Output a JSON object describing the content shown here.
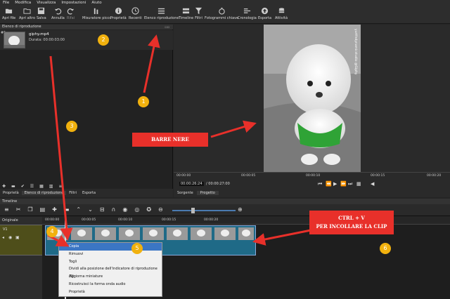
{
  "menubar": [
    "File",
    "Modifica",
    "Visualizza",
    "Impostazioni",
    "Aiuto"
  ],
  "toolbar": [
    {
      "label": "Apri file",
      "icon": "folder-icon"
    },
    {
      "label": "Apri altro",
      "icon": "folder-open-icon"
    },
    {
      "label": "Salva",
      "icon": "save-icon"
    },
    {
      "label": "Annulla",
      "icon": "undo-icon"
    },
    {
      "label": "Rifai",
      "icon": "redo-icon"
    },
    {
      "label": "Misuratore picco",
      "icon": "peak-meter-icon"
    },
    {
      "label": "Proprietà",
      "icon": "info-icon"
    },
    {
      "label": "Recenti",
      "icon": "clock-icon"
    },
    {
      "label": "Elenco riproduzione",
      "icon": "list-icon"
    },
    {
      "label": "Timeline",
      "icon": "timeline-icon"
    },
    {
      "label": "Filtri",
      "icon": "filter-icon"
    },
    {
      "label": "Fotogrammi chiave",
      "icon": "stopwatch-icon"
    },
    {
      "label": "Cronologia",
      "icon": "history-icon"
    },
    {
      "label": "Esporta",
      "icon": "export-icon"
    },
    {
      "label": "Attività",
      "icon": "tasks-icon"
    }
  ],
  "playlist": {
    "title": "Elenco di riproduzione",
    "index": "#1",
    "clip_name": "giphy.mp4",
    "clip_duration": "Durata: 00:00:03:00"
  },
  "viewer": {
    "watermark": "yurtfedynamicstudio @Giphy",
    "ruler_ticks": [
      "00:00:00",
      "00:00:05",
      "00:00:10",
      "00:00:15",
      "00:00:20"
    ],
    "timecode": "00:00:26:24",
    "total": "/ 00:00:27:00",
    "tabs": [
      "Sorgente",
      "Progetto"
    ]
  },
  "left_tabs": [
    "Proprietà",
    "Elenco di riproduzione",
    "Filtri",
    "Esporta"
  ],
  "timeline": {
    "title": "Timeline",
    "track_header": "Originale",
    "track_name": "V1",
    "ruler_ticks": [
      "00:00:00",
      "00:00:05",
      "00:00:10",
      "00:00:15",
      "00:00:20"
    ]
  },
  "context_menu": {
    "items": [
      "Copia",
      "Rimuovi",
      "Togli",
      "Dividi alla posizione dell'indicatore di riproduzione (S)",
      "Aggiorna miniature",
      "Ricostruisci la forma onda audio",
      "Proprietà"
    ],
    "selected": 0
  },
  "annotations": {
    "barre_nere": "BARRE NERE",
    "ctrl_v": "CTRL + V",
    "per_incollare": "PER INCOLLARE LA CLIP",
    "badges": [
      "1",
      "2",
      "3",
      "4",
      "5",
      "6"
    ]
  },
  "colors": {
    "badge": "#f1b10e",
    "arrow": "#e8302a",
    "clip": "#1f6a87",
    "selection": "#3b76c4"
  }
}
